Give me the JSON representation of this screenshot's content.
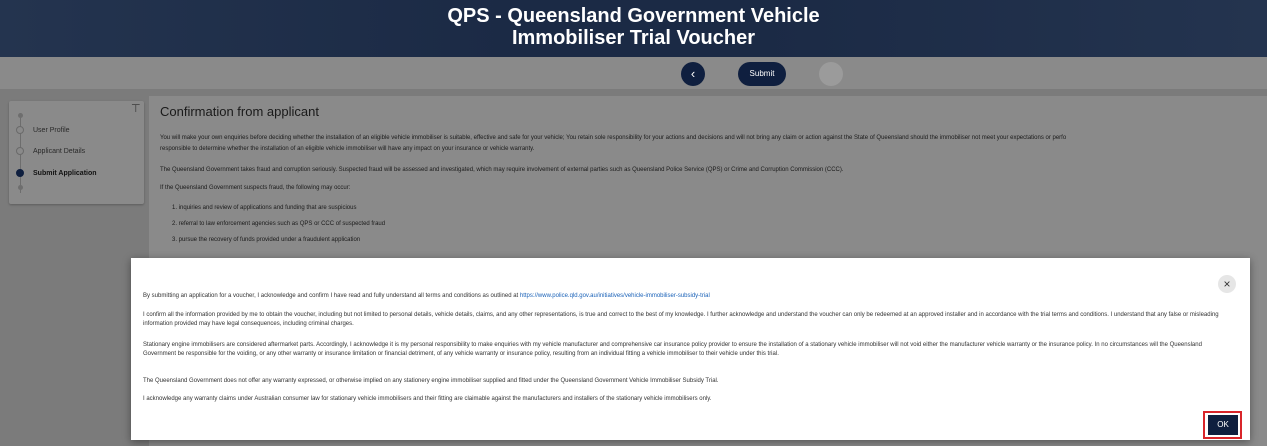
{
  "header": {
    "title_line1": "QPS - Queensland Government Vehicle",
    "title_line2": "Immobiliser Trial Voucher"
  },
  "toolbar": {
    "back_icon": "‹",
    "submit_label": "Submit"
  },
  "sidebar": {
    "collapse_icon": "⊤",
    "steps": [
      {
        "label": "User Profile"
      },
      {
        "label": "Applicant Details"
      },
      {
        "label": "Submit Application"
      }
    ]
  },
  "main": {
    "title": "Confirmation from applicant",
    "para1a": "You will make your own enquiries before deciding whether the installation of an eligible vehicle immobiliser is suitable, effective and safe for your vehicle; You retain sole responsibility for your actions and decisions and will not bring any claim or action against the State of Queensland should the immobiliser not meet your expectations or perfo",
    "para1b": "responsible to determine whether the installation of an eligible vehicle immobiliser will have any impact on your insurance or vehicle warranty.",
    "para2": "The Queensland Government takes fraud and corruption seriously. Suspected fraud will be assessed and investigated, which may require involvement of external parties such as Queensland Police Service (QPS) or Crime and Corruption Commission (CCC).",
    "para3": "If the Queensland Government suspects fraud, the following may occur:",
    "list": [
      "1. inquiries and review of applications and funding that are suspicious",
      "2. referral to law enforcement agencies such as QPS or CCC of suspected fraud",
      "3. pursue the recovery of funds provided under a fraudulent application"
    ]
  },
  "modal": {
    "close_icon": "×",
    "p1_text": "By submitting an application for a voucher, I acknowledge and confirm I have read and fully understand all terms and conditions as outlined at ",
    "p1_link": "https://www.police.qld.gov.au/initiatives/vehicle-immobiliser-subsidy-trial",
    "p2": "I confirm all the information provided by me to obtain the voucher, including but not limited to personal details, vehicle details, claims, and any other representations, is true and correct to the best of my knowledge. I further acknowledge and understand  the voucher can only be redeemed at an approved installer and in accordance with the trial terms and conditions. I understand that any false or misleading information provided may have legal consequences, including criminal charges.",
    "p3": "Stationary engine immobilisers are considered aftermarket parts. Accordingly, I acknowledge it is my personal responsibility to make enquiries with my vehicle manufacturer and comprehensive car insurance policy provider to ensure the installation of a stationary vehicle immobiliser will not void either the manufacturer vehicle warranty or the insurance policy.  In no circumstances will the Queensland Government be responsible for the voiding, or any other warranty or insurance limitation or financial detriment, of any vehicle warranty or insurance policy, resulting from an individual fitting a vehicle immobiliser to their vehicle under this trial.",
    "p4": "The Queensland Government does not offer any warranty expressed, or otherwise implied on any stationery engine immobiliser supplied and fitted under the Queensland Government Vehicle Immobiliser Subsidy Trial.",
    "p5": "I acknowledge any warranty claims under Australian consumer law for stationary vehicle immobilisers and their fitting are claimable against the manufacturers and installers of the stationary vehicle immobilisers only.",
    "ok_label": "OK"
  }
}
